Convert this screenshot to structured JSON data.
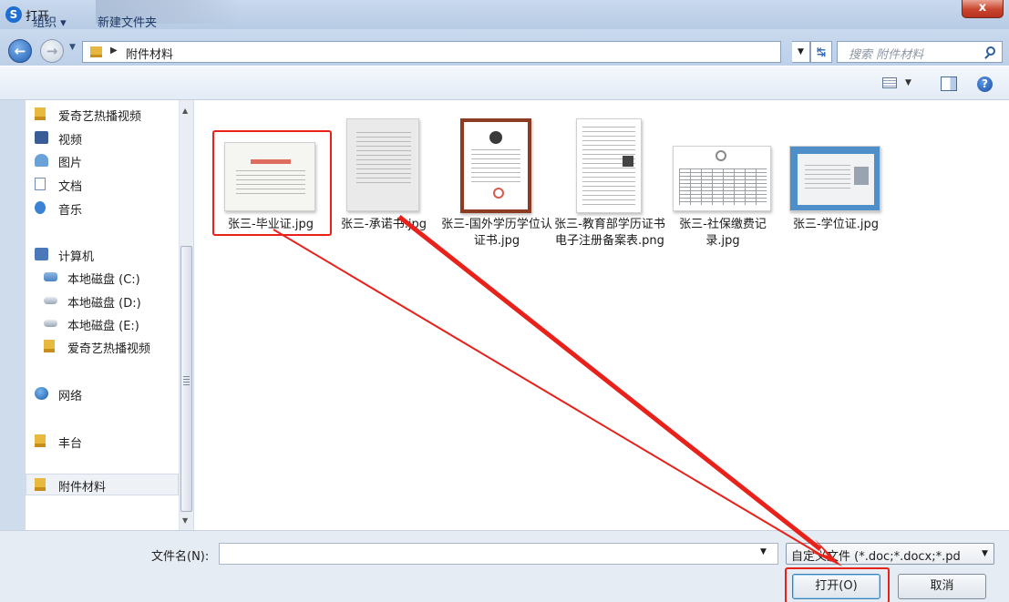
{
  "window": {
    "title": "打开",
    "close_label": "x"
  },
  "navigation": {
    "address_path": "附件材料",
    "search_placeholder": "搜索 附件材料"
  },
  "toolbar": {
    "organize_label": "组织 ▾",
    "new_folder_label": "新建文件夹"
  },
  "sidebar": {
    "items": [
      {
        "label": "爱奇艺热播视频",
        "icon": "folder-icon"
      },
      {
        "label": "视频",
        "icon": "video-library-icon"
      },
      {
        "label": "图片",
        "icon": "picture-library-icon"
      },
      {
        "label": "文档",
        "icon": "document-library-icon"
      },
      {
        "label": "音乐",
        "icon": "music-library-icon"
      },
      {
        "label": "计算机",
        "icon": "computer-icon"
      },
      {
        "label": "本地磁盘 (C:)",
        "icon": "system-drive-icon"
      },
      {
        "label": "本地磁盘 (D:)",
        "icon": "drive-icon"
      },
      {
        "label": "本地磁盘 (E:)",
        "icon": "drive-icon"
      },
      {
        "label": "爱奇艺热播视频",
        "icon": "folder-icon"
      },
      {
        "label": "网络",
        "icon": "network-icon"
      },
      {
        "label": "丰台",
        "icon": "folder-icon"
      },
      {
        "label": "附件材料",
        "icon": "folder-icon",
        "selected": true
      }
    ]
  },
  "files": [
    {
      "name": "张三-毕业证.jpg",
      "highlighted": true
    },
    {
      "name": "张三-承诺书.jpg"
    },
    {
      "name": "张三-国外学历学位认证书.jpg"
    },
    {
      "name": "张三-教育部学历证书电子注册备案表.png"
    },
    {
      "name": "张三-社保缴费记录.jpg"
    },
    {
      "name": "张三-学位证.jpg"
    }
  ],
  "footer": {
    "filename_label": "文件名(N):",
    "filename_value": "",
    "filetype_value": "自定义文件 (*.doc;*.docx;*.pd",
    "open_label": "打开(O)",
    "cancel_label": "取消"
  },
  "annotation": {
    "color": "#e8221b"
  }
}
